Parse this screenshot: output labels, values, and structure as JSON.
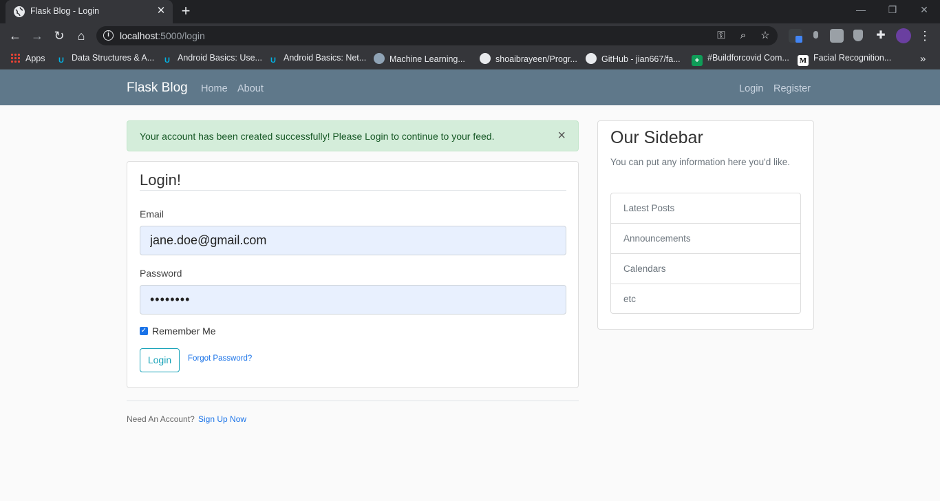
{
  "browser": {
    "tab_title": "Flask Blog - Login",
    "url_host": "localhost",
    "url_path": ":5000/login",
    "bookmarks": [
      {
        "label": "Apps",
        "icon": "apps-grid-icon"
      },
      {
        "label": "Data Structures & A...",
        "icon": "udacity-icon"
      },
      {
        "label": "Android Basics: Use...",
        "icon": "udacity-icon"
      },
      {
        "label": "Android Basics: Net...",
        "icon": "udacity-icon"
      },
      {
        "label": "Machine Learning...",
        "icon": "brain-icon"
      },
      {
        "label": "shoaibrayeen/Progr...",
        "icon": "github-icon"
      },
      {
        "label": "GitHub - jian667/fa...",
        "icon": "github-icon"
      },
      {
        "label": "#Buildforcovid Com...",
        "icon": "plus-flag-icon"
      },
      {
        "label": "Facial Recognition...",
        "icon": "medium-icon"
      }
    ],
    "overflow": "»"
  },
  "site": {
    "brand": "Flask Blog",
    "nav_left": [
      "Home",
      "About"
    ],
    "nav_right": [
      "Login",
      "Register"
    ],
    "nav_color": "#5f788a"
  },
  "alert": {
    "message": "Your account has been created successfully! Please Login to continue to your feed.",
    "close": "×"
  },
  "login": {
    "legend": "Login!",
    "email_label": "Email",
    "email_value": "jane.doe@gmail.com",
    "password_label": "Password",
    "password_value": "••••••••",
    "remember_label": "Remember Me",
    "remember_checked": true,
    "submit": "Login",
    "forgot": "Forgot Password?"
  },
  "footer": {
    "need_account": "Need An Account?",
    "signup": "Sign Up Now"
  },
  "sidebar": {
    "title": "Our Sidebar",
    "text": "You can put any information here you'd like.",
    "items": [
      "Latest Posts",
      "Announcements",
      "Calendars",
      "etc"
    ]
  }
}
